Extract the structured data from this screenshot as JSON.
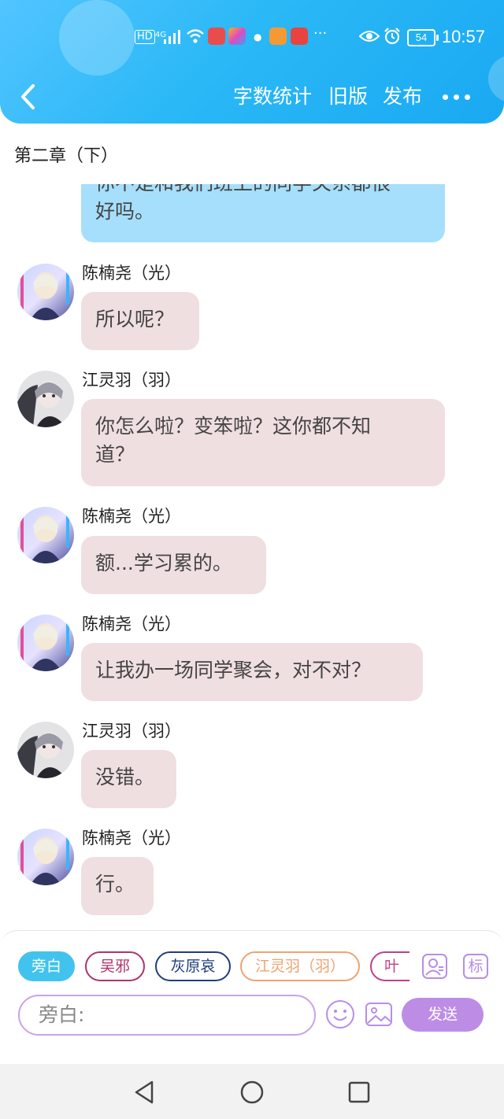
{
  "status_bar": {
    "network_left": "HD",
    "network_type": "4G",
    "battery": "54",
    "time": "10:57",
    "more": "···"
  },
  "nav": {
    "back_icon": "chevron-left-icon",
    "word_count": "字数统计",
    "old_version": "旧版",
    "publish": "发布",
    "more_icon": "more-dots-icon"
  },
  "chapter_title": "第二章（下）",
  "messages": [
    {
      "type": "narration-partial",
      "lines": [
        "你不是和我们班上的同学关系都很",
        "好吗。"
      ]
    },
    {
      "speaker": "陈楠尧（光）",
      "text": "所以呢？",
      "avatar": "avatar-light-hair"
    },
    {
      "speaker": "江灵羽（羽）",
      "text_lines": [
        "你怎么啦？变笨啦？这你都不知",
        "道？"
      ],
      "avatar": "avatar-dark-hair"
    },
    {
      "speaker": "陈楠尧（光）",
      "text": "额...学习累的。",
      "avatar": "avatar-light-hair"
    },
    {
      "speaker": "陈楠尧（光）",
      "text": "让我办一场同学聚会，对不对？",
      "avatar": "avatar-light-hair"
    },
    {
      "speaker": "江灵羽（羽）",
      "text": "没错。",
      "avatar": "avatar-dark-hair"
    },
    {
      "speaker": "陈楠尧（光）",
      "text": "行。",
      "avatar": "avatar-light-hair"
    }
  ],
  "roles": [
    {
      "label": "旁白",
      "color": "#42c3ee",
      "selected": true
    },
    {
      "label": "吴邪",
      "color": "#b0336b"
    },
    {
      "label": "灰原哀",
      "color": "#1f3e7d"
    },
    {
      "label": "江灵羽（羽）",
      "color": "#f0a36e"
    },
    {
      "label": "叶",
      "color": "#c0408a"
    }
  ],
  "tools": {
    "role_manage_icon": "person-badge-icon",
    "mark_label": "标"
  },
  "input": {
    "placeholder": "旁白:",
    "emoji_icon": "smile-icon",
    "image_icon": "image-icon",
    "send_label": "发送"
  },
  "system_nav": {
    "back": "triangle-back-icon",
    "home": "circle-home-icon",
    "recents": "square-recents-icon"
  },
  "colors": {
    "header_blue": "#2ab8f6",
    "bubble_pink": "#f0dfe0",
    "bubble_blue": "#a6dffb",
    "accent_purple": "#bd8de6"
  }
}
